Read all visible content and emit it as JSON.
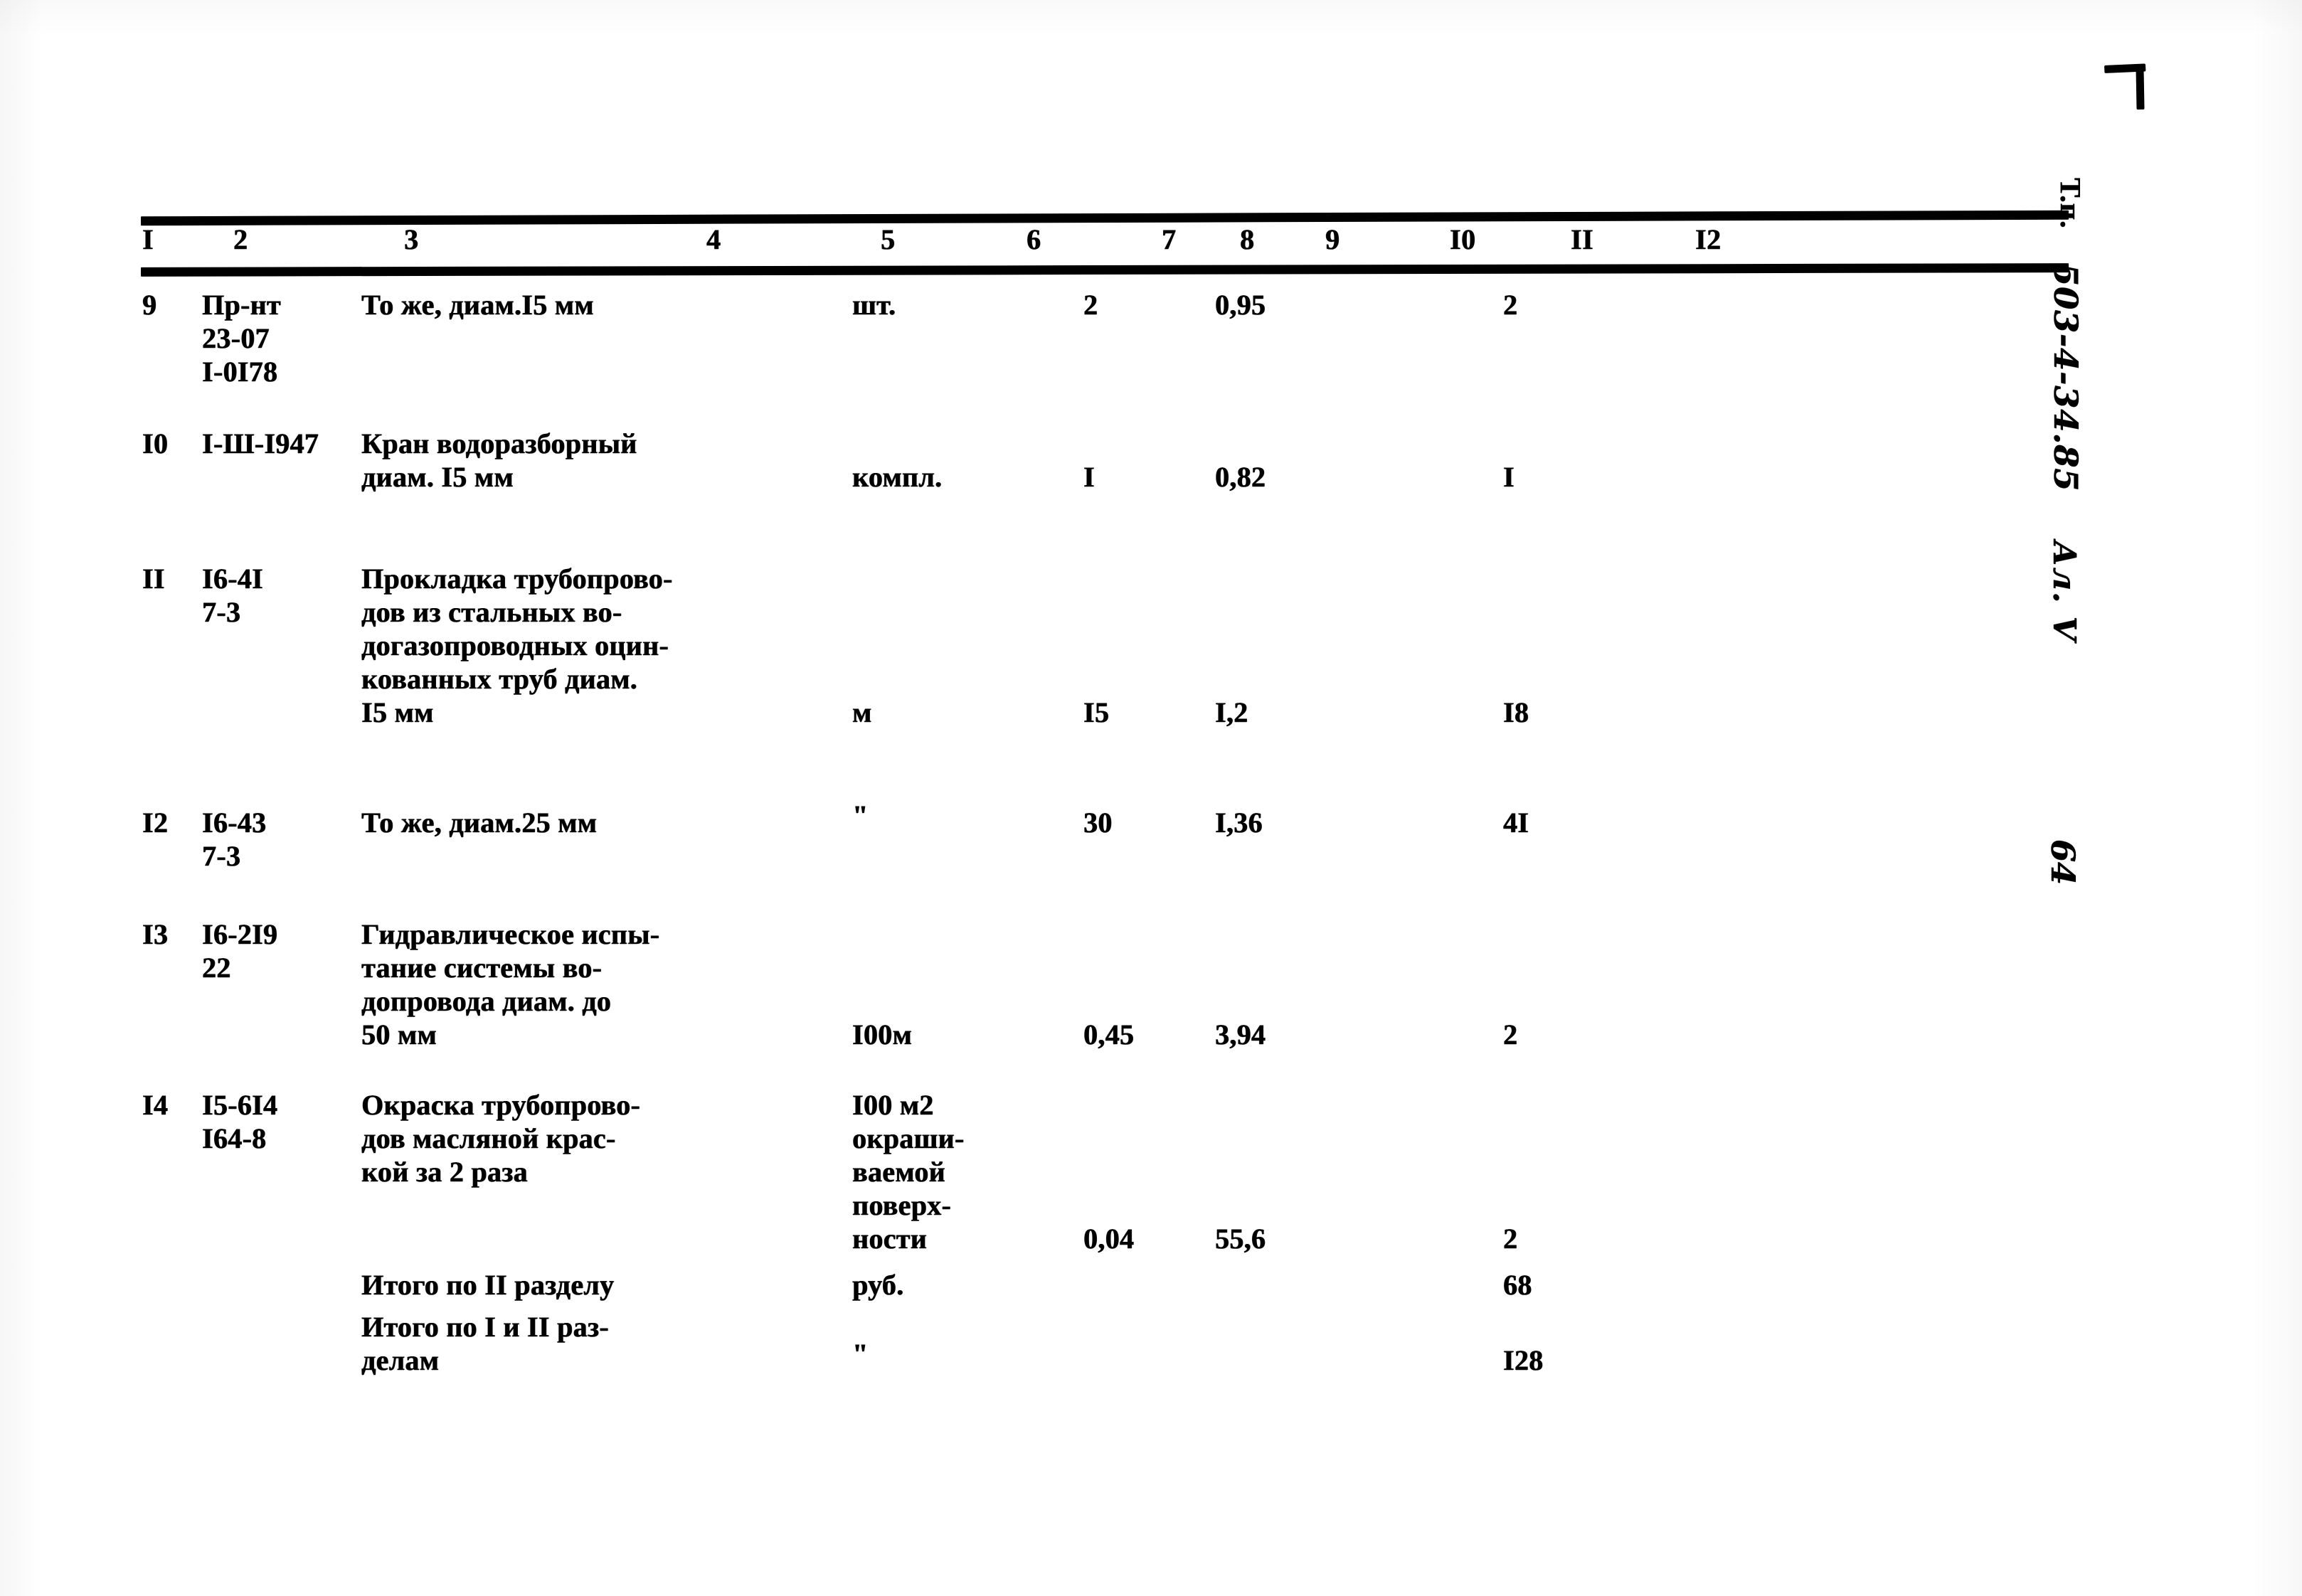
{
  "document": {
    "type": "construction-estimate-table",
    "corner_mark": "registration-corner-mark"
  },
  "table": {
    "column_headers": [
      "I",
      "2",
      "3",
      "4",
      "5",
      "6",
      "7",
      "8",
      "9",
      "I0",
      "II",
      "I2"
    ],
    "rows": [
      {
        "n": "9",
        "code": "Пр-нт\n23-07\nI-0I78",
        "description": "То же, диам.I5 мм",
        "unit": "шт.",
        "qty": "2",
        "price": "0,95",
        "total": "2"
      },
      {
        "n": "I0",
        "code": "I-Ш-I947",
        "description": "Кран водоразборный\nдиам. I5 мм",
        "unit": "компл.",
        "qty": "I",
        "price": "0,82",
        "total": "I"
      },
      {
        "n": "II",
        "code": "I6-4I\n7-3",
        "description": "Прокладка трубопрово-\nдов из стальных во-\nдогазопроводных оцин-\nкованных труб диам.\nI5 мм",
        "unit": "м",
        "qty": "I5",
        "price": "I,2",
        "total": "I8"
      },
      {
        "n": "I2",
        "code": "I6-43\n7-3",
        "description": "То же, диам.25 мм",
        "unit": "\"",
        "qty": "30",
        "price": "I,36",
        "total": "4I"
      },
      {
        "n": "I3",
        "code": "I6-2I9\n22",
        "description": "Гидравлическое испы-\nтание системы во-\nдопровода диам. до\n50 мм",
        "unit": "I00м",
        "qty": "0,45",
        "price": "3,94",
        "total": "2"
      },
      {
        "n": "I4",
        "code": "I5-6I4\nI64-8",
        "description": "Окраска трубопрово-\nдов масляной крас-\nкой за 2 раза",
        "unit": "I00 м2\nокраши-\nваемой\nповерх-\nности",
        "qty": "0,04",
        "price": "55,6",
        "total": "2"
      }
    ],
    "summary_rows": [
      {
        "description": "Итого по II разделу",
        "unit": "руб.",
        "total": "68"
      },
      {
        "description": "Итого по I и II раз-\nделам",
        "unit": "\"",
        "total": "I28"
      }
    ]
  },
  "margin": {
    "series_label": "Т.п.",
    "project_code": "503-4-34.85",
    "album": "Ал. V",
    "page_number": "64"
  }
}
